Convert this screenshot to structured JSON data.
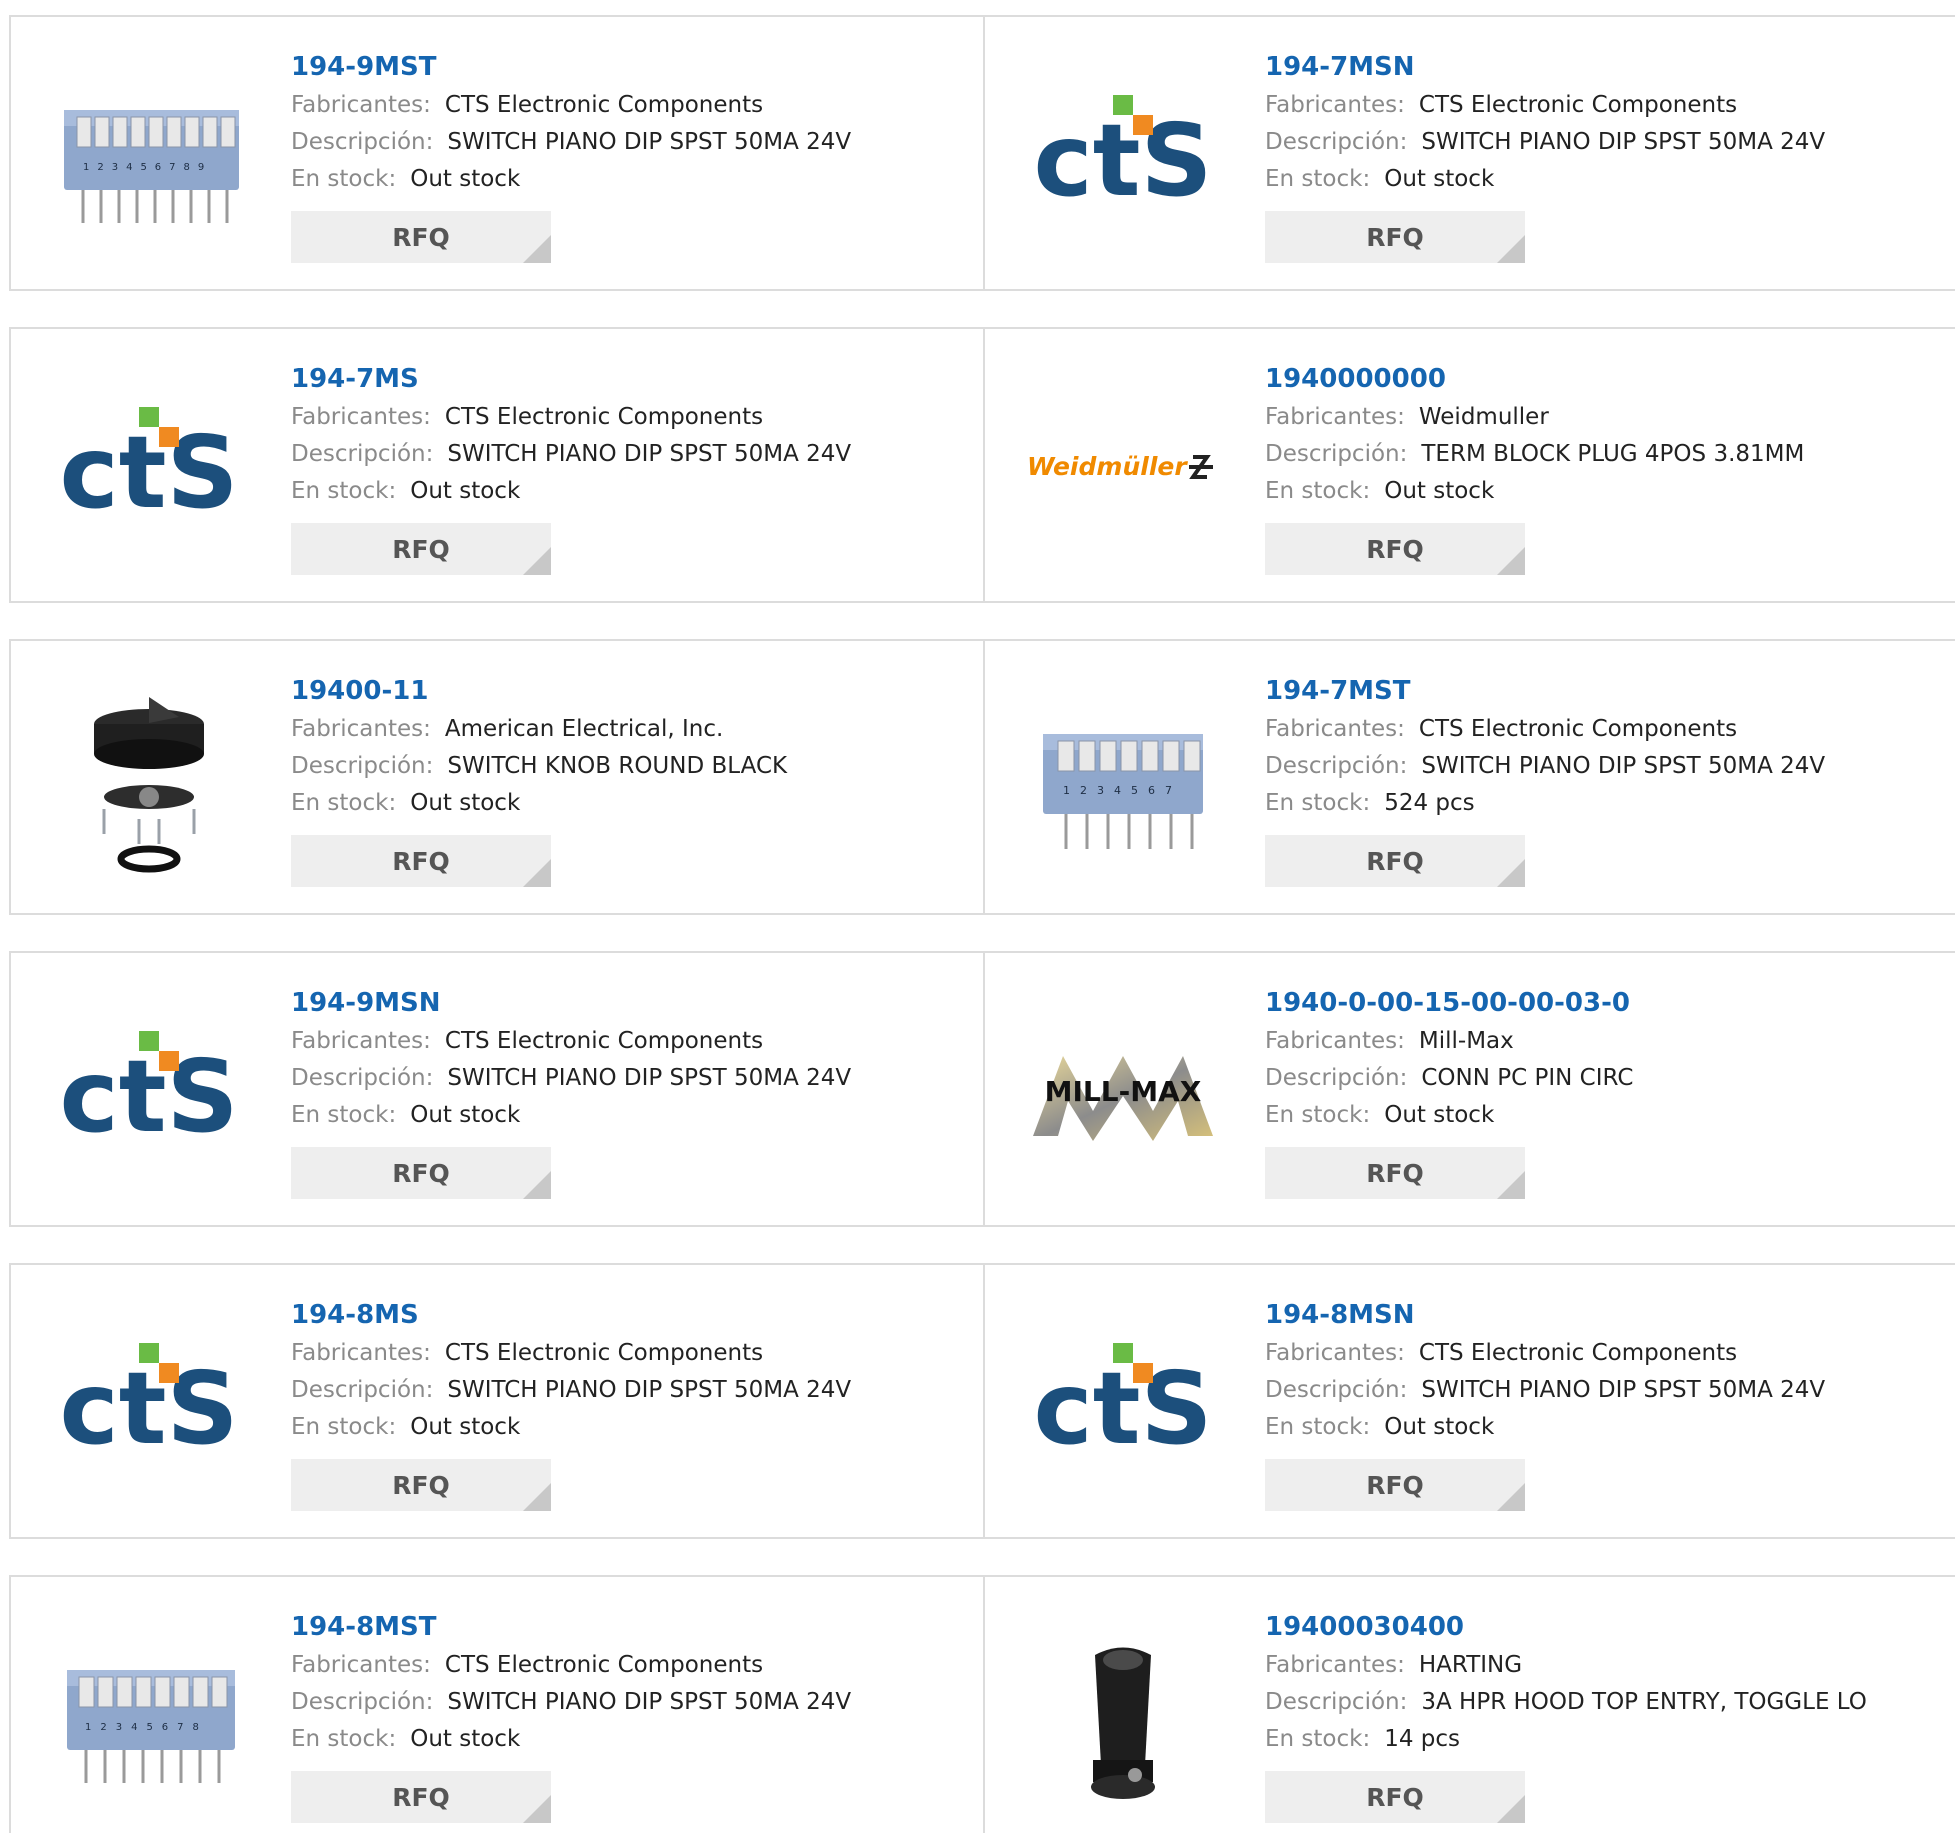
{
  "labels": {
    "manufacturer": "Fabricantes:",
    "description": "Descripción:",
    "stock": "En stock:",
    "rfq": "RFQ"
  },
  "colors": {
    "link": "#1565b0",
    "label": "#8a8a8a",
    "cts_blue": "#1c4f7c",
    "cts_orange": "#f08a21",
    "cts_green": "#6abb45",
    "weidmuller_orange": "#f08a00"
  },
  "products": [
    {
      "part": "194-9MST",
      "manufacturer": "CTS Electronic Components",
      "description": "SWITCH PIANO DIP SPST 50MA 24V",
      "stock": "Out stock",
      "image": "dip-switch-9"
    },
    {
      "part": "194-7MSN",
      "manufacturer": "CTS Electronic Components",
      "description": "SWITCH PIANO DIP SPST 50MA 24V",
      "stock": "Out stock",
      "image": "cts-logo"
    },
    {
      "part": "194-7MS",
      "manufacturer": "CTS Electronic Components",
      "description": "SWITCH PIANO DIP SPST 50MA 24V",
      "stock": "Out stock",
      "image": "cts-logo"
    },
    {
      "part": "1940000000",
      "manufacturer": "Weidmuller",
      "description": "TERM BLOCK PLUG 4POS 3.81MM",
      "stock": "Out stock",
      "image": "weidmuller-logo",
      "logo_text": "Weidmüller"
    },
    {
      "part": "19400-11",
      "manufacturer": "American Electrical, Inc.",
      "description": "SWITCH KNOB ROUND BLACK",
      "stock": "Out stock",
      "image": "knob"
    },
    {
      "part": "194-7MST",
      "manufacturer": "CTS Electronic Components",
      "description": "SWITCH PIANO DIP SPST 50MA 24V",
      "stock": "524 pcs",
      "image": "dip-switch-7"
    },
    {
      "part": "194-9MSN",
      "manufacturer": "CTS Electronic Components",
      "description": "SWITCH PIANO DIP SPST 50MA 24V",
      "stock": "Out stock",
      "image": "cts-logo"
    },
    {
      "part": "1940-0-00-15-00-00-03-0",
      "manufacturer": "Mill-Max",
      "description": "CONN PC PIN CIRC",
      "stock": "Out stock",
      "image": "millmax-logo",
      "logo_text": "MILL-MAX"
    },
    {
      "part": "194-8MS",
      "manufacturer": "CTS Electronic Components",
      "description": "SWITCH PIANO DIP SPST 50MA 24V",
      "stock": "Out stock",
      "image": "cts-logo"
    },
    {
      "part": "194-8MSN",
      "manufacturer": "CTS Electronic Components",
      "description": "SWITCH PIANO DIP SPST 50MA 24V",
      "stock": "Out stock",
      "image": "cts-logo"
    },
    {
      "part": "194-8MST",
      "manufacturer": "CTS Electronic Components",
      "description": "SWITCH PIANO DIP SPST 50MA 24V",
      "stock": "Out stock",
      "image": "dip-switch-8"
    },
    {
      "part": "19400030400",
      "manufacturer": "HARTING",
      "description": "3A HPR HOOD TOP ENTRY, TOGGLE LO",
      "stock": "14 pcs",
      "image": "harting-hood"
    }
  ]
}
